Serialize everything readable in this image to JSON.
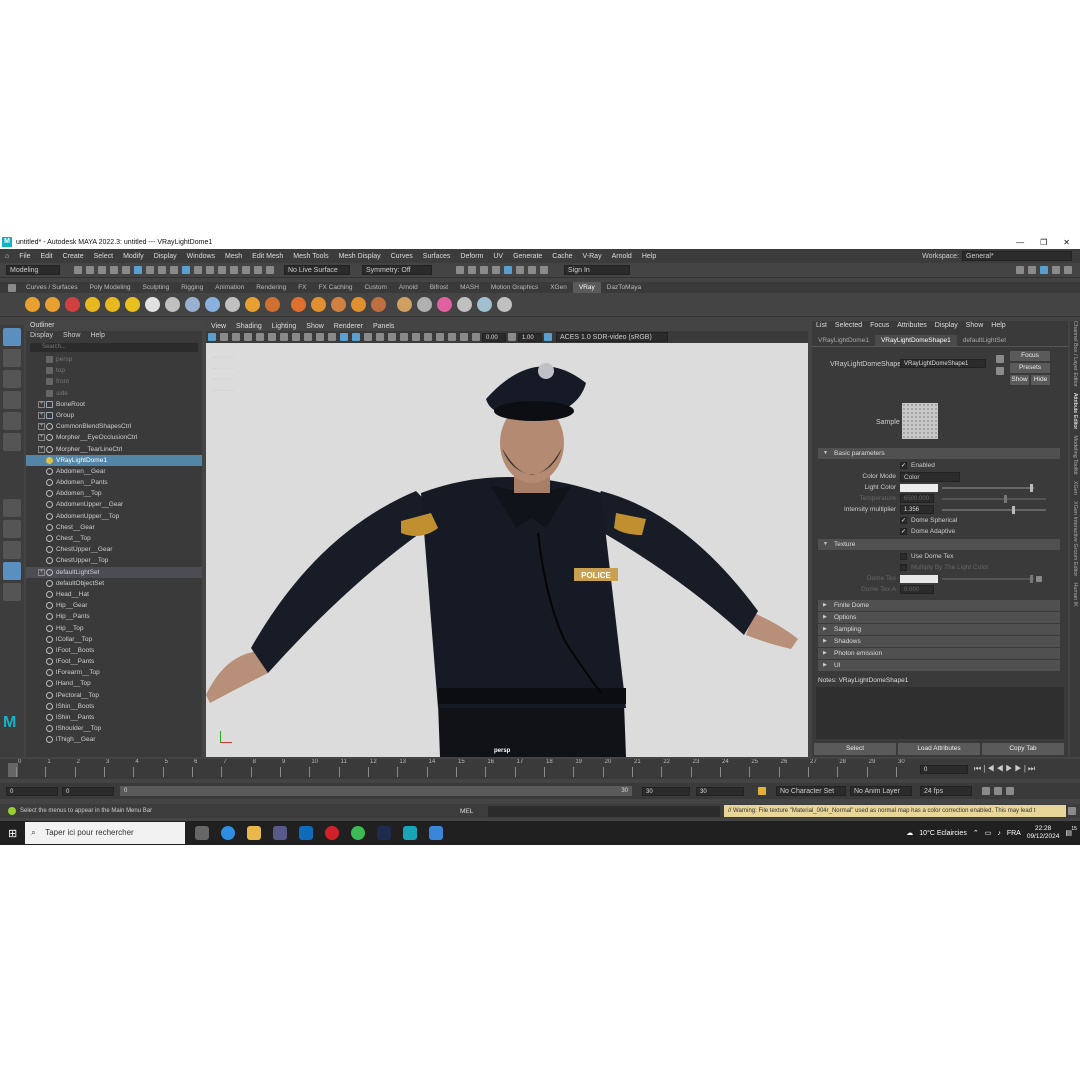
{
  "window": {
    "title": "untitled* - Autodesk MAYA 2022.3: untitled   ---   VRayLightDome1",
    "logo": "M"
  },
  "menubar": {
    "items": [
      "File",
      "Edit",
      "Create",
      "Select",
      "Modify",
      "Display",
      "Windows",
      "Mesh",
      "Edit Mesh",
      "Mesh Tools",
      "Mesh Display",
      "Curves",
      "Surfaces",
      "Deform",
      "UV",
      "Generate",
      "Cache",
      "V-Ray",
      "Arnold",
      "Help"
    ],
    "workspace_label": "Workspace:",
    "workspace_value": "General*"
  },
  "statusline": {
    "mode": "Modeling",
    "live_surface": "No Live Surface",
    "symmetry": "Symmetry: Off",
    "sign_in": "Sign In"
  },
  "shelf": {
    "tabs": [
      "Curves / Surfaces",
      "Poly Modeling",
      "Sculpting",
      "Rigging",
      "Animation",
      "Rendering",
      "FX",
      "FX Caching",
      "Custom",
      "Arnold",
      "Bifrost",
      "MASH",
      "Motion Graphics",
      "XGen",
      "VRay",
      "DazToMaya"
    ],
    "active_tab": "VRay",
    "icon_colors": [
      "#e8a030",
      "#e8a030",
      "#d04040",
      "#e8b820",
      "#e8b820",
      "#e8c020",
      "#e0e0e0",
      "#c0c0c0",
      "#9ab0d0",
      "#8ab0e0",
      "#c0c0c0",
      "#e8a030",
      "#d07030",
      "#e07030",
      "#e09030",
      "#d08040",
      "#e09030",
      "#c07040",
      "#d0a060",
      "#b0b0b0",
      "#e060a0",
      "#c0c0c0",
      "#a0c0d0",
      "#c0c0c0"
    ]
  },
  "outliner": {
    "title": "Outliner",
    "menu": [
      "Display",
      "Show",
      "Help"
    ],
    "search_placeholder": "Search...",
    "items": [
      {
        "label": "persp",
        "type": "cam",
        "dim": true
      },
      {
        "label": "top",
        "type": "cam",
        "dim": true
      },
      {
        "label": "front",
        "type": "cam",
        "dim": true
      },
      {
        "label": "side",
        "type": "cam",
        "dim": true
      },
      {
        "label": "BoneRoot",
        "type": "group",
        "expand": true
      },
      {
        "label": "Group",
        "type": "group",
        "expand": true
      },
      {
        "label": "CommonBlendShapesCtrl",
        "type": "curve",
        "expand": true
      },
      {
        "label": "Morpher__EyeOcclusionCtrl",
        "type": "curve",
        "expand": true
      },
      {
        "label": "Morpher__TearLineCtrl",
        "type": "curve",
        "expand": true
      },
      {
        "label": "VRayLightDome1",
        "type": "light",
        "selected": true
      },
      {
        "label": "Abdomen__Gear",
        "type": "set"
      },
      {
        "label": "Abdomen__Pants",
        "type": "set"
      },
      {
        "label": "Abdomen__Top",
        "type": "set"
      },
      {
        "label": "AbdomenUpper__Gear",
        "type": "set"
      },
      {
        "label": "AbdomenUpper__Top",
        "type": "set"
      },
      {
        "label": "Chest__Gear",
        "type": "set"
      },
      {
        "label": "Chest__Top",
        "type": "set"
      },
      {
        "label": "ChestUpper__Gear",
        "type": "set"
      },
      {
        "label": "ChestUpper__Top",
        "type": "set"
      },
      {
        "label": "defaultLightSet",
        "type": "set",
        "expand": true,
        "highlight": true
      },
      {
        "label": "defaultObjectSet",
        "type": "set"
      },
      {
        "label": "Head__Hat",
        "type": "set"
      },
      {
        "label": "Hip__Gear",
        "type": "set"
      },
      {
        "label": "Hip__Pants",
        "type": "set"
      },
      {
        "label": "Hip__Top",
        "type": "set"
      },
      {
        "label": "lCollar__Top",
        "type": "set"
      },
      {
        "label": "lFoot__Boots",
        "type": "set"
      },
      {
        "label": "lFoot__Pants",
        "type": "set"
      },
      {
        "label": "lForearm__Top",
        "type": "set"
      },
      {
        "label": "lHand__Top",
        "type": "set"
      },
      {
        "label": "lPectoral__Top",
        "type": "set"
      },
      {
        "label": "lShin__Boots",
        "type": "set"
      },
      {
        "label": "lShin__Pants",
        "type": "set"
      },
      {
        "label": "lShoulder__Top",
        "type": "set"
      },
      {
        "label": "lThigh__Gear",
        "type": "set"
      }
    ]
  },
  "viewport": {
    "menu": [
      "View",
      "Shading",
      "Lighting",
      "Show",
      "Renderer",
      "Panels"
    ],
    "exposure": "0.00",
    "gamma": "1.00",
    "colorspace": "ACES 1.0 SDR-video (sRGB)",
    "camera_label": "persp",
    "badge_text": "POLICE"
  },
  "attribute_editor": {
    "menu": [
      "List",
      "Selected",
      "Focus",
      "Attributes",
      "Display",
      "Show",
      "Help"
    ],
    "tabs": [
      "VRayLightDome1",
      "VRayLightDomeShape1",
      "defaultLightSet"
    ],
    "active_tab": "VRayLightDomeShape1",
    "node_label": "VRayLightDomeShape:",
    "node_value": "VRayLightDomeShape1",
    "focus": "Focus",
    "presets": "Presets",
    "show": "Show",
    "hide": "Hide",
    "sample_label": "Sample",
    "basic_section": "Basic parameters",
    "enabled": "Enabled",
    "color_mode_label": "Color Mode",
    "color_mode_value": "Color",
    "light_color_label": "Light Color",
    "temperature_label": "Temperature",
    "temperature_value": "6500.000",
    "intensity_label": "Intensity multiplier",
    "intensity_value": "1.356",
    "dome_spherical": "Dome Spherical",
    "dome_adaptive": "Dome Adaptive",
    "texture_section": "Texture",
    "use_dome_tex": "Use Dome Tex",
    "multiply_light_color": "Multiply By The Light Color",
    "dome_tex_label": "Dome Tex",
    "dome_tex_a_label": "Dome Tex A",
    "dome_tex_a_value": "0.000",
    "collapsed_sections": [
      "Finite Dome",
      "Options",
      "Sampling",
      "Shadows",
      "Photon emission",
      "UI"
    ],
    "notes_label": "Notes:  VRayLightDomeShape1",
    "buttons": [
      "Select",
      "Load Attributes",
      "Copy Tab"
    ],
    "side_tabs": [
      "Channel Box / Layer Editor",
      "Attribute Editor",
      "Modeling Toolkit",
      "XGen",
      "XGen Interactive Groom Editor",
      "Human IK"
    ]
  },
  "timeline": {
    "ticks": [
      "0",
      "1",
      "2",
      "3",
      "4",
      "5",
      "6",
      "7",
      "8",
      "9",
      "10",
      "11",
      "12",
      "13",
      "14",
      "15",
      "16",
      "17",
      "18",
      "19",
      "20",
      "21",
      "22",
      "23",
      "24",
      "25",
      "26",
      "27",
      "28",
      "29",
      "30"
    ],
    "current_frame": "0",
    "range_start": "0",
    "range_inner_start": "0",
    "range_slider_start": "0",
    "range_slider_end": "30",
    "range_inner_end": "30",
    "range_end": "30",
    "character_set": "No Character Set",
    "anim_layer": "No Anim Layer",
    "fps": "24 fps"
  },
  "helpline": {
    "help_text": "Select the menus to appear in the Main Menu Bar",
    "mel_label": "MEL",
    "warning": "// Warning: File texture \"Material_004r_Normal\" used as normal map has a color correction enabled. This may lead t"
  },
  "taskbar": {
    "search_placeholder": "Taper ici pour rechercher",
    "weather": "10°C  Eclaircies",
    "language": "FRA",
    "time": "22:28",
    "date": "09/12/2024",
    "notification_count": "15"
  },
  "colors": {
    "accent": "#5285a6",
    "viewport_bg": "#dcdcdc",
    "uniform": "#161a24",
    "warning_bg": "#e8d598",
    "shelf_active": "#5a5a5a"
  }
}
